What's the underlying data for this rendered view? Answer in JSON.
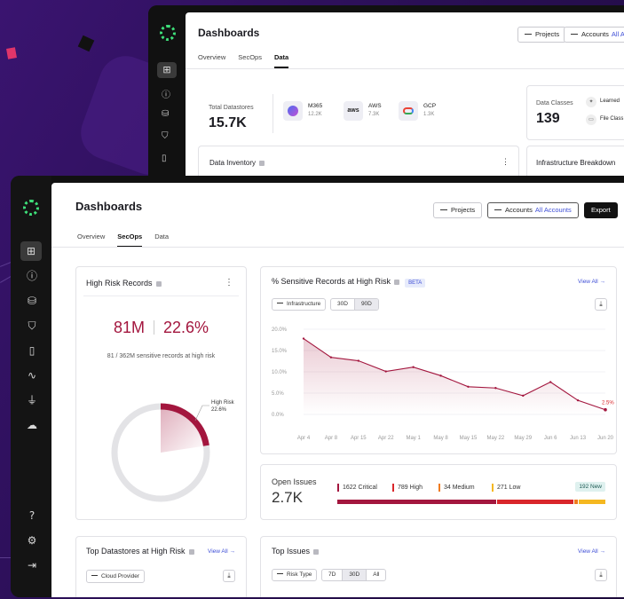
{
  "colors": {
    "accent": "#3f4fd6",
    "brand": "#3ee07a",
    "risk": "#a3163e",
    "critical": "#a3163e",
    "high": "#d9262b",
    "medium": "#f07b1f",
    "low": "#f5b821",
    "new_badge_bg": "#dff1ef"
  },
  "back_window": {
    "title": "Dashboards",
    "tabs": [
      "Overview",
      "SecOps",
      "Data"
    ],
    "active_tab": "Data",
    "projects_label": "Projects",
    "accounts_label": "Accounts",
    "accounts_value": "All Acc",
    "total_datastores_label": "Total Datastores",
    "total_datastores_value": "15.7K",
    "sources": [
      {
        "name": "M365",
        "count": "12.2K",
        "icon": "m365-icon"
      },
      {
        "name": "AWS",
        "count": "7.3K",
        "icon": "aws-icon"
      },
      {
        "name": "GCP",
        "count": "1.3K",
        "icon": "gcp-icon"
      }
    ],
    "data_classes_label": "Data Classes",
    "data_classes_value": "139",
    "learned_label": "Learned",
    "file_classes_label": "File Class",
    "data_inventory_label": "Data Inventory",
    "infra_breakdown_label": "Infrastructure Breakdown"
  },
  "sidebar": {
    "icons": [
      "grid-icon",
      "alert-icon",
      "database-icon",
      "shield-icon",
      "book-icon",
      "pulse-icon",
      "plug-icon",
      "cloud-icon"
    ],
    "bottom_icons": [
      "help-icon",
      "settings-icon",
      "logout-icon"
    ]
  },
  "header": {
    "title": "Dashboards",
    "tabs": [
      "Overview",
      "SecOps",
      "Data"
    ],
    "active_tab": "SecOps",
    "projects_label": "Projects",
    "accounts_label": "Accounts",
    "accounts_value": "All Accounts",
    "export_label": "Export"
  },
  "high_risk": {
    "title": "High Risk Records",
    "count": "81M",
    "percent": "22.6%",
    "subtitle": "81 / 362M sensitive records at high risk",
    "donut_label": "High Risk",
    "donut_value": "22.6%",
    "fraction": 0.226
  },
  "sensitive": {
    "title": "% Sensitive Records at High Risk",
    "badge": "BETA",
    "view_all": "View All",
    "filter_label": "Infrastructure",
    "ranges": [
      "30D",
      "90D"
    ],
    "active_range": "90D",
    "end_label": "2.5%"
  },
  "chart_data": {
    "type": "area",
    "x": [
      "Apr 4",
      "Apr 8",
      "Apr 15",
      "Apr 22",
      "May 1",
      "May 8",
      "May 15",
      "May 22",
      "May 29",
      "Jun 6",
      "Jun 13",
      "Jun 20"
    ],
    "values": [
      17.8,
      13.4,
      12.6,
      10.1,
      11.1,
      9.1,
      6.5,
      6.2,
      4.4,
      7.6,
      3.3,
      1.1
    ],
    "ylim": [
      0,
      20
    ],
    "yticks": [
      "20.0%",
      "15.0%",
      "10.0%",
      "5.0%",
      "0.0%"
    ],
    "grid": true
  },
  "open_issues": {
    "title": "Open Issues",
    "total": "2.7K",
    "new_badge": "192 New",
    "items": [
      {
        "label": "1622 Critical",
        "value": 1622
      },
      {
        "label": "789 High",
        "value": 789
      },
      {
        "label": "34 Medium",
        "value": 34
      },
      {
        "label": "271 Low",
        "value": 271
      }
    ]
  },
  "top_datastores": {
    "title": "Top Datastores at High Risk",
    "view_all": "View All",
    "filter_label": "Cloud Provider"
  },
  "top_issues": {
    "title": "Top Issues",
    "view_all": "View All",
    "filter_label": "Risk Type",
    "ranges": [
      "7D",
      "30D",
      "All"
    ],
    "active_range": "30D"
  }
}
